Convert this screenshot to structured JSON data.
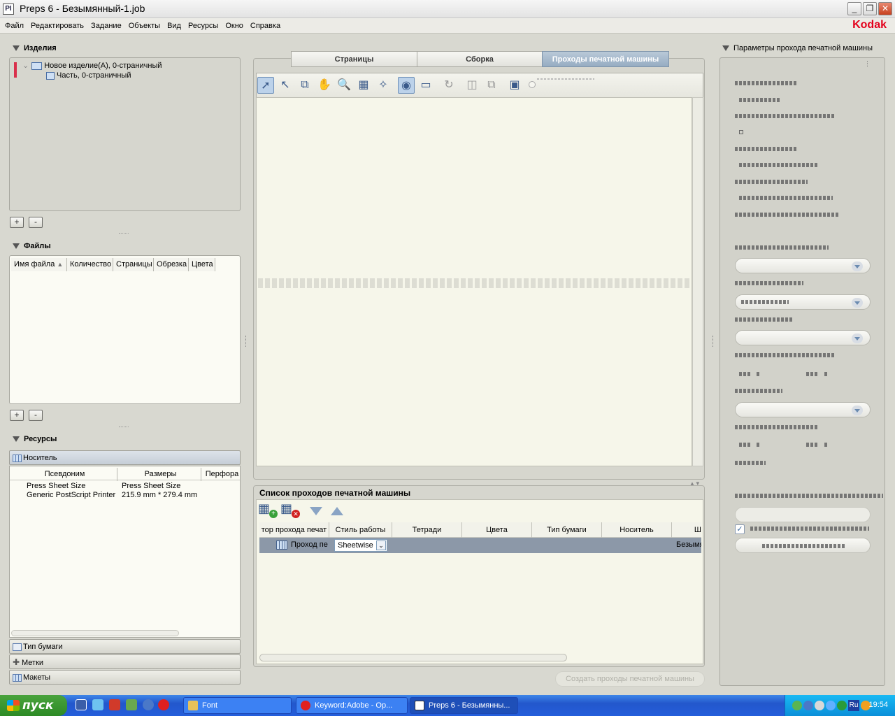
{
  "window": {
    "title": "Preps 6 - Безымянный-1.job",
    "app_icon": "PI",
    "min": "_",
    "restore": "❐",
    "close": "✕"
  },
  "menu": [
    "Файл",
    "Редактировать",
    "Задание",
    "Объекты",
    "Вид",
    "Ресурсы",
    "Окно",
    "Справка"
  ],
  "brand": "Kodak",
  "left": {
    "products": {
      "title": "Изделия",
      "tree": [
        {
          "label": "Новое изделие(A), 0-страничный"
        },
        {
          "label": "Часть, 0-страничный"
        }
      ],
      "add": "+",
      "remove": "-"
    },
    "files": {
      "title": "Файлы",
      "columns": [
        "Имя файла",
        "Количество",
        "Страницы",
        "Обрезка",
        "Цвета"
      ],
      "add": "+",
      "remove": "-"
    },
    "resources": {
      "title": "Ресурсы",
      "active_tab": "Носитель",
      "columns": [
        "Псевдоним",
        "Размеры",
        "Перфора"
      ],
      "rows": [
        [
          "Press Sheet Size",
          "Press Sheet Size"
        ],
        [
          "Generic PostScript Printer",
          "215.9 mm * 279.4 mm"
        ]
      ],
      "tabs": [
        "Тип бумаги",
        "Метки",
        "Макеты"
      ]
    }
  },
  "center": {
    "tabs": [
      "Страницы",
      "Сборка",
      "Проходы печатной машины"
    ],
    "active_tab": 2,
    "tools": [
      "pointer-icon",
      "small-pointer-icon",
      "page-select-icon",
      "hand-icon",
      "zoom-icon",
      "grid-icon",
      "wand-icon",
      "eye-icon",
      "ruler-icon",
      "rotate-icon",
      "flip-icon",
      "copy-icon",
      "monitor-icon"
    ],
    "list": {
      "title": "Список проходов печатной машины",
      "columns": [
        "тор прохода печат",
        "Стиль работы",
        "Тетради",
        "Цвета",
        "Тип бумаги",
        "Носитель",
        "Ш"
      ],
      "row": {
        "name": "Проход пе",
        "style": "Sheetwise",
        "media": "Безымян"
      }
    },
    "create_button": "Создать проходы печатной машины"
  },
  "right": {
    "title": "Параметры прохода печатной машины"
  },
  "taskbar": {
    "start": "пуск",
    "tasks": [
      "Font",
      "Keyword:Adobe - Op...",
      "Preps 6 - Безымянны..."
    ],
    "active_task": 2,
    "lang": "Ru",
    "clock": "19:54"
  },
  "colors": {
    "accent": "#96acc2",
    "brand": "#e3001b",
    "selected_row": "#8c98a8",
    "taskbar": "#245edb"
  }
}
